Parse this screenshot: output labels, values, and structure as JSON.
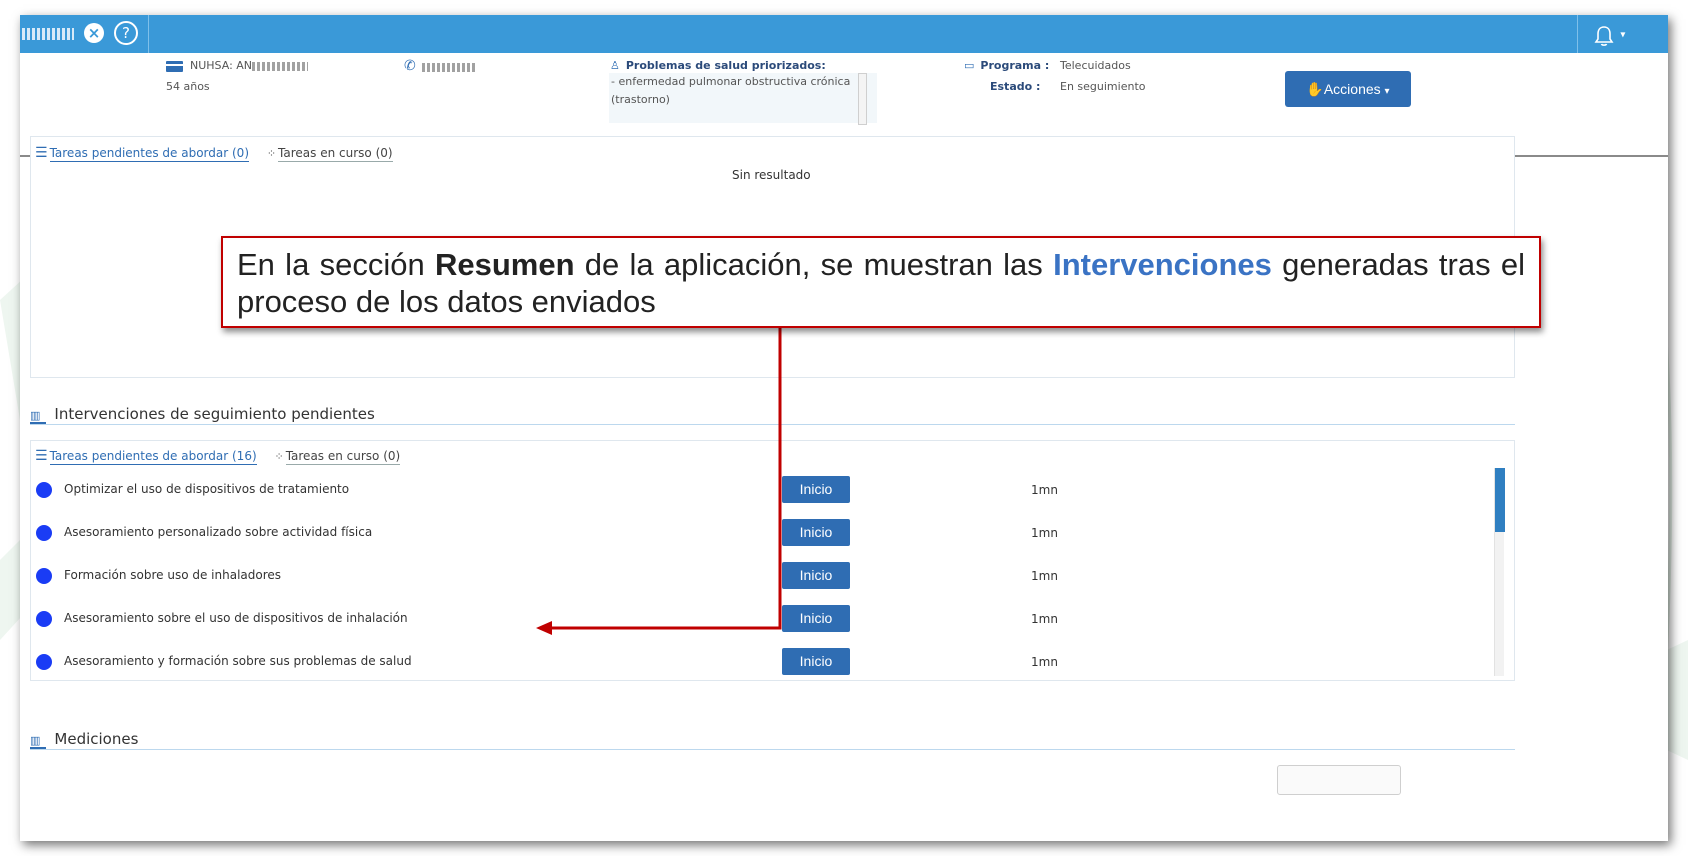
{
  "header": {
    "close_icon": "×",
    "help_icon": "?",
    "bell_icon": "bell-icon",
    "caret": "▾"
  },
  "patient": {
    "nuhsa_label": "NUHSA: AN",
    "age": "54 años",
    "problems_title": "Problemas de salud priorizados:",
    "problems_lines": [
      "- enfermedad pulmonar obstructiva crónica",
      "(trastorno)"
    ],
    "program_label": "Programa :",
    "program_value": "Telecuidados",
    "state_label": "Estado :",
    "state_value": "En seguimiento",
    "actions_label": "Acciones",
    "actions_caret": "▾"
  },
  "panel1": {
    "tab_pending": "Tareas pendientes de abordar (0)",
    "tab_in_progress": "Tareas en curso (0)",
    "no_result": "Sin resultado"
  },
  "interventions": {
    "title": "Intervenciones de seguimiento pendientes",
    "tab_pending": "Tareas pendientes de abordar (16)",
    "tab_in_progress": "Tareas en curso (0)",
    "tasks": [
      {
        "label": "Optimizar el uso de dispositivos de tratamiento",
        "button": "Inicio",
        "time": "1mn"
      },
      {
        "label": "Asesoramiento personalizado sobre actividad física",
        "button": "Inicio",
        "time": "1mn"
      },
      {
        "label": "Formación sobre uso de inhaladores",
        "button": "Inicio",
        "time": "1mn"
      },
      {
        "label": "Asesoramiento sobre el uso de dispositivos de inhalación",
        "button": "Inicio",
        "time": "1mn"
      },
      {
        "label": "Asesoramiento y formación sobre sus problemas de salud",
        "button": "Inicio",
        "time": "1mn"
      }
    ]
  },
  "measurements": {
    "title": "Mediciones"
  },
  "callout": {
    "text_before": "En la sección ",
    "bold": "Resumen",
    "text_middle": " de la aplicación, se muestran las ",
    "highlight": "Intervenciones",
    "text_after": " generadas tras el proceso de los datos enviados"
  },
  "colors": {
    "topbar": "#3a99d8",
    "primary_button": "#2f6db3",
    "task_dot": "#1a3cf5",
    "callout_border": "#c00000",
    "arrow": "#c00000",
    "highlight": "#3a73c4"
  }
}
